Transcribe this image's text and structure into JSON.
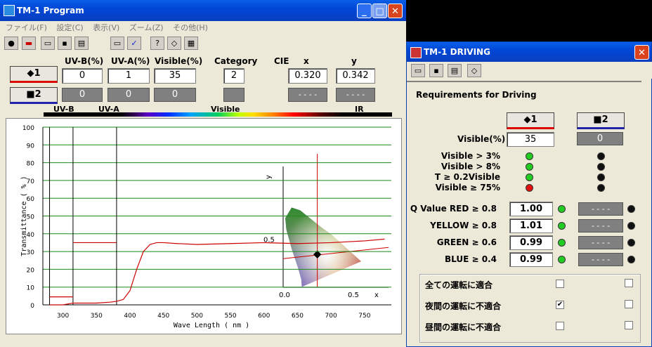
{
  "main": {
    "title": "TM-1 Program",
    "menu": [
      "ファイル(F)",
      "設定(C)",
      "表示(V)",
      "ズーム(Z)",
      "その他(H)"
    ],
    "headers": {
      "uvb": "UV-B(%)",
      "uva": "UV-A(%)",
      "vis": "Visible(%)",
      "cat": "Category",
      "cie": "CIE",
      "x": "x",
      "y": "y"
    },
    "sample1": {
      "label": "◆1",
      "uvb": "0",
      "uva": "1",
      "vis": "35",
      "cat": "2",
      "x": "0.320",
      "y": "0.342"
    },
    "sample2": {
      "label": "■2",
      "uvb": "0",
      "uva": "0",
      "vis": "0",
      "cat": "",
      "x": "- - - -",
      "y": "- - - -"
    },
    "spectrum_labels": {
      "uvb": "UV-B",
      "uva": "UV-A",
      "vis": "Visible",
      "ir": "IR"
    },
    "chart_data": {
      "type": "line",
      "ylabel": "Transmittance ( % )",
      "xlabel": "Wave Length ( nm )",
      "xlim": [
        270,
        790
      ],
      "ylim": [
        0,
        100
      ],
      "xticks": [
        300,
        350,
        400,
        450,
        500,
        550,
        600,
        650,
        700,
        750
      ],
      "yticks": [
        0,
        10,
        20,
        30,
        40,
        50,
        60,
        70,
        80,
        90,
        100
      ],
      "series": [
        {
          "x": [
            280,
            300,
            315,
            330,
            350,
            370,
            380,
            390,
            400,
            410,
            420,
            430,
            440,
            450,
            470,
            500,
            550,
            600,
            650,
            700,
            750,
            780
          ],
          "y": [
            0,
            0,
            1,
            1,
            1,
            1.5,
            2,
            3,
            8,
            20,
            30,
            34,
            35,
            35,
            34.5,
            34,
            34.5,
            35,
            34.5,
            35,
            36,
            37
          ]
        }
      ],
      "uv_bands": [
        {
          "x": [
            280,
            315
          ],
          "y": 4.5
        },
        {
          "x": [
            315,
            380
          ],
          "y": 35
        }
      ],
      "cie_inset": {
        "x": 0.32,
        "y": 0.342,
        "xticks": [
          "0.0",
          "0.5",
          "x"
        ],
        "yticks": [
          "0.5",
          "y"
        ]
      }
    }
  },
  "drive": {
    "title": "TM-1 DRIVING",
    "heading": "Requirements for Driving",
    "btn1": "◆1",
    "btn2": "■2",
    "visible_label": "Visible(%)",
    "visible1": "35",
    "visible2": "0",
    "checks": [
      {
        "label": "Visible > 3%",
        "s1": "#22cc22",
        "s2": "#111111"
      },
      {
        "label": "Visible > 8%",
        "s1": "#22cc22",
        "s2": "#111111"
      },
      {
        "label": "T ≥ 0.2Visible",
        "s1": "#22cc22",
        "s2": "#111111"
      },
      {
        "label": "Visible ≥ 75%",
        "s1": "#e01010",
        "s2": "#111111"
      }
    ],
    "qvalues": [
      {
        "label": "Q Value RED ≥ 0.8",
        "v1": "1.00",
        "v2": "- - - -"
      },
      {
        "label": "YELLOW ≥ 0.8",
        "v1": "1.01",
        "v2": "- - - -"
      },
      {
        "label": "GREEN ≥ 0.6",
        "v1": "0.99",
        "v2": "- - - -"
      },
      {
        "label": "BLUE ≥ 0.4",
        "v1": "0.99",
        "v2": "- - - -"
      }
    ],
    "summary": [
      {
        "label": "全ての運転に適合",
        "c1": "",
        "c2": ""
      },
      {
        "label": "夜間の運転に不適合",
        "c1": "✔",
        "c2": ""
      },
      {
        "label": "昼間の運転に不適合",
        "c1": "",
        "c2": ""
      }
    ]
  }
}
